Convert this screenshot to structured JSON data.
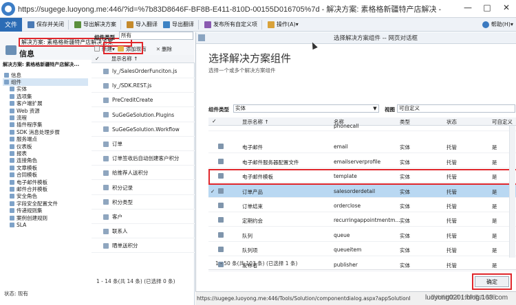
{
  "browser": {
    "url": "https://sugege.luoyong.me:446/?id=%7b83D8646F-BF8B-E411-810D-00155D016705%7d - 解决方案: 素格格新疆特产店解决 -",
    "min": "—",
    "max": "□",
    "close": "✕"
  },
  "ribbon": {
    "file": "文件",
    "buttons": [
      {
        "label": "保存并关闭",
        "icon": "save-close-icon",
        "color": "#4a7ab5"
      },
      {
        "label": "导出解决方案",
        "icon": "export-solution-icon",
        "color": "#5b8f3d"
      },
      {
        "label": "导入翻译",
        "icon": "import-translation-icon",
        "color": "#c58a2c"
      },
      {
        "label": "导出翻译",
        "icon": "export-translation-icon",
        "color": "#3d82c4"
      },
      {
        "label": "发布所有自定义项",
        "icon": "publish-all-icon",
        "color": "#8a5ab0"
      },
      {
        "label": "操作(A)▾",
        "icon": "actions-icon",
        "color": "#d9a23a"
      }
    ],
    "help": "帮助(H)▾"
  },
  "header": {
    "breadcrumb": "解决方案: 素格格新疆特产店解决方案",
    "title": "信息",
    "solution_name": "解决方案: 素格格新疆特产店解决..."
  },
  "nav": {
    "items": [
      {
        "label": "信息",
        "child": false
      },
      {
        "label": "组件",
        "child": false,
        "selected": true
      },
      {
        "label": "实体",
        "child": true
      },
      {
        "label": "选项集",
        "child": true
      },
      {
        "label": "客户端扩展",
        "child": true
      },
      {
        "label": "Web 资源",
        "child": true
      },
      {
        "label": "流程",
        "child": true
      },
      {
        "label": "插件程序集",
        "child": true
      },
      {
        "label": "SDK 消息处理步骤",
        "child": true
      },
      {
        "label": "服务端点",
        "child": true
      },
      {
        "label": "仪表板",
        "child": true
      },
      {
        "label": "报表",
        "child": true
      },
      {
        "label": "连接角色",
        "child": true
      },
      {
        "label": "文章模板",
        "child": true
      },
      {
        "label": "合同模板",
        "child": true
      },
      {
        "label": "电子邮件模板",
        "child": true
      },
      {
        "label": "邮件合并模板",
        "child": true
      },
      {
        "label": "安全角色",
        "child": true
      },
      {
        "label": "字段安全配置文件",
        "child": true
      },
      {
        "label": "传递规则集",
        "child": true
      },
      {
        "label": "案例创建规则",
        "child": true
      },
      {
        "label": "SLA",
        "child": true
      }
    ],
    "status": "状态: 现有"
  },
  "components": {
    "type_label": "组件类型",
    "type_value": "所有",
    "new": "新建",
    "add_existing": "添加现有",
    "delete": "删除",
    "column_header": "显示名称 ↑",
    "rows": [
      "ly_/SalesOrderFunciton.js",
      "ly_/SDK.REST.js",
      "PreCreditCreate",
      "SuGeGeSolution.Plugins",
      "SuGeGeSolution.Workflow",
      "订单",
      "订单签收后自动创建客户积分",
      "给推荐人送积分",
      "积分记录",
      "积分类型",
      "客户",
      "联系人",
      "晒单送积分"
    ],
    "paging": "1 - 14 条(共 14 条) (已选择 0 条)"
  },
  "dialog": {
    "window_title": "选择解决方案组件 -- 网页对话框",
    "heading": "选择解决方案组件",
    "subheading": "选择一个或多个解决方案组件",
    "filter_type_label": "组件类型",
    "filter_type_value": "实体",
    "view_label": "视图",
    "view_value": "可自定义",
    "columns": [
      "显示名称 ↑",
      "名称",
      "类型",
      "状态",
      "可自定义"
    ],
    "rows": [
      {
        "display": "",
        "name": "phonecall",
        "type": "",
        "state": "",
        "custom": ""
      },
      {
        "display": "电子邮件",
        "name": "email",
        "type": "实体",
        "state": "托管",
        "custom": "是"
      },
      {
        "display": "电子邮件服务器配置文件",
        "name": "emailserverprofile",
        "type": "实体",
        "state": "托管",
        "custom": "是"
      },
      {
        "display": "电子邮件模板",
        "name": "template",
        "type": "实体",
        "state": "托管",
        "custom": "是"
      },
      {
        "display": "订单产品",
        "name": "salesorderdetail",
        "type": "实体",
        "state": "托管",
        "custom": "是",
        "selected": true
      },
      {
        "display": "订单结束",
        "name": "orderclose",
        "type": "实体",
        "state": "托管",
        "custom": "是"
      },
      {
        "display": "定期约会",
        "name": "recurringappointmentm...",
        "type": "实体",
        "state": "托管",
        "custom": "是"
      },
      {
        "display": "队列",
        "name": "queue",
        "type": "实体",
        "state": "托管",
        "custom": "是"
      },
      {
        "display": "队列项",
        "name": "queueitem",
        "type": "实体",
        "state": "托管",
        "custom": "是"
      },
      {
        "display": "发布者",
        "name": "publisher",
        "type": "实体",
        "state": "托管",
        "custom": "是"
      }
    ],
    "paging": "1 - 50 条(共 103 条) (已选择 1 条)",
    "ok": "确定"
  },
  "statusbar": {
    "url": "https://sugege.luoyong.me:446/Tools/Solution/componentdialog.aspx?appSolutionI",
    "zone": "受信任的站点 | 保护模式: 禁用"
  },
  "watermark": "luoyong0201.blog.163.com"
}
